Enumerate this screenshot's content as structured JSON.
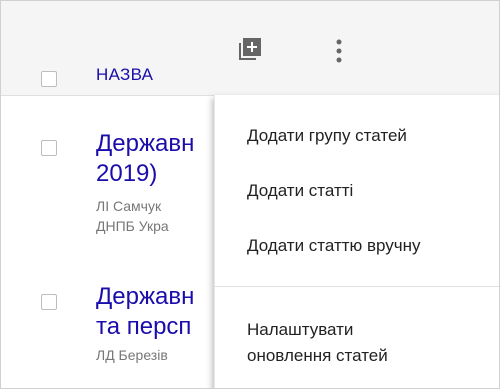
{
  "header": {
    "column_title": "НАЗВА",
    "add_icon": "add-box-icon",
    "more_icon": "more-vertical-icon"
  },
  "rows": [
    {
      "title_line1": "Державн",
      "title_line2": "2019)",
      "meta_line1": "ЛІ Самчук",
      "meta_line2": "ДНПБ Укра"
    },
    {
      "title_line1": "Державн",
      "title_line2": "та персп",
      "meta_line1": "ЛД Березів"
    }
  ],
  "menu": {
    "items": [
      "Додати групу статей",
      "Додати статті",
      "Додати статтю вручну"
    ],
    "settings_line1": "Налаштувати",
    "settings_line2": "оновлення статей"
  },
  "colors": {
    "link": "#1a0dab",
    "header_bg": "#f5f5f5",
    "icon": "#666666"
  }
}
